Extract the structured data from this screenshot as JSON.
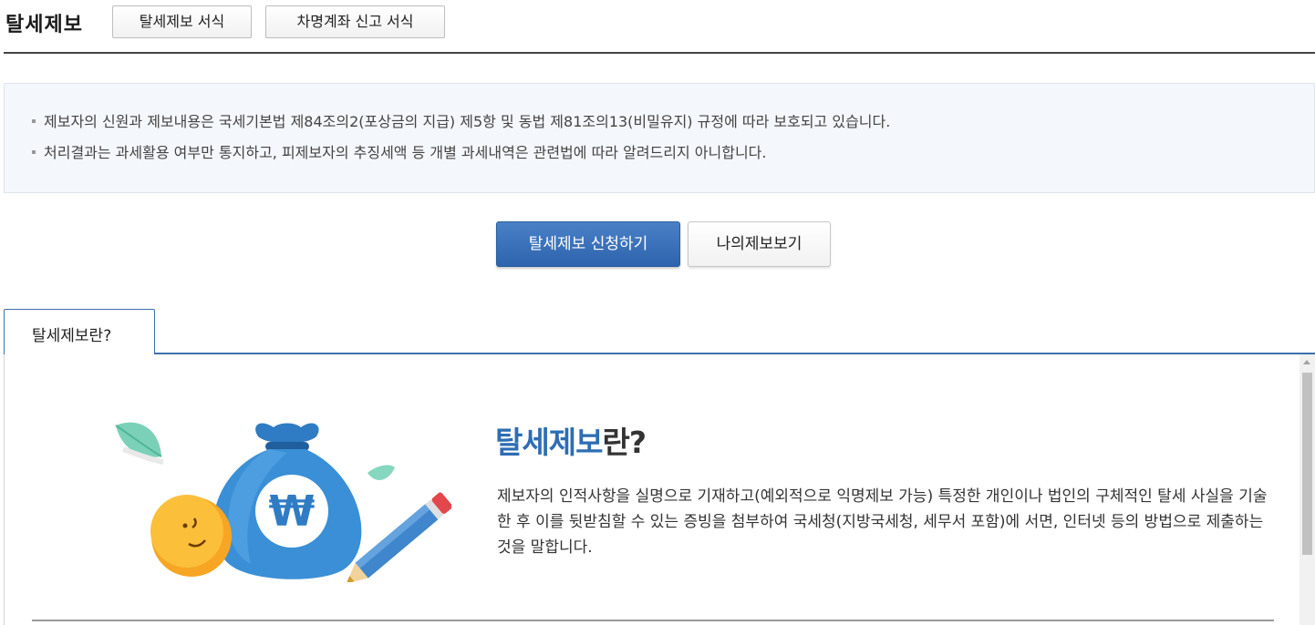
{
  "header": {
    "title": "탈세제보",
    "buttons": [
      "탈세제보 서식",
      "차명계좌 신고 서식"
    ]
  },
  "notice": {
    "items": [
      "제보자의 신원과 제보내용은 국세기본법 제84조의2(포상금의 지급) 제5항 및 동법 제81조의13(비밀유지) 규정에 따라 보호되고 있습니다.",
      "처리결과는 과세활용 여부만 통지하고, 피제보자의 추징세액 등 개별 과세내역은 관련법에 따라 알려드리지 아니합니다."
    ]
  },
  "actions": {
    "apply_label": "탈세제보 신청하기",
    "my_reports_label": "나의제보보기"
  },
  "tabs": [
    {
      "label": "탈세제보란?",
      "active": true
    }
  ],
  "content": {
    "title_highlight": "탈세제보",
    "title_rest": "란?",
    "description": "제보자의 인적사항을 실명으로 기재하고(예외적으로 익명제보 가능) 특정한 개인이나 법인의 구체적인 탈세 사실을 기술한 후 이를 뒷받침할 수 있는 증빙을 첨부하여 국세청(지방국세청, 세무서 포함)에 서면, 인터넷 등의 방법으로 제출하는 것을 말합니다.",
    "illustration_icons": [
      "money-bag-icon",
      "won-sign-icon",
      "coin-face-icon",
      "pencil-icon",
      "leaf-icon"
    ]
  },
  "colors": {
    "primary_button": "#2d64ad",
    "title_blue": "#2d6db3",
    "tab_border": "#3b6fb0",
    "notice_bg": "#f4f7fb"
  }
}
